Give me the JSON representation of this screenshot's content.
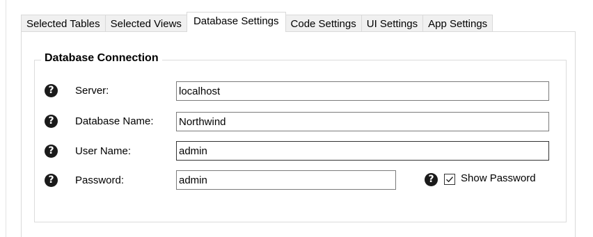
{
  "tabs": [
    {
      "label": "Selected Tables"
    },
    {
      "label": "Selected Views"
    },
    {
      "label": "Database Settings",
      "active": true
    },
    {
      "label": "Code Settings"
    },
    {
      "label": "UI Settings"
    },
    {
      "label": "App Settings"
    }
  ],
  "group": {
    "title": "Database Connection"
  },
  "fields": {
    "server": {
      "label": "Server:",
      "value": "localhost",
      "icon": "question-icon"
    },
    "database_name": {
      "label": "Database Name:",
      "value": "Northwind",
      "icon": "question-icon"
    },
    "user_name": {
      "label": "User Name:",
      "value": "admin",
      "icon": "question-icon"
    },
    "password": {
      "label": "Password:",
      "value": "admin",
      "icon": "question-icon"
    }
  },
  "show_password": {
    "label": "Show Password",
    "checked": true,
    "icon": "question-icon"
  },
  "icon_glyph": "?"
}
